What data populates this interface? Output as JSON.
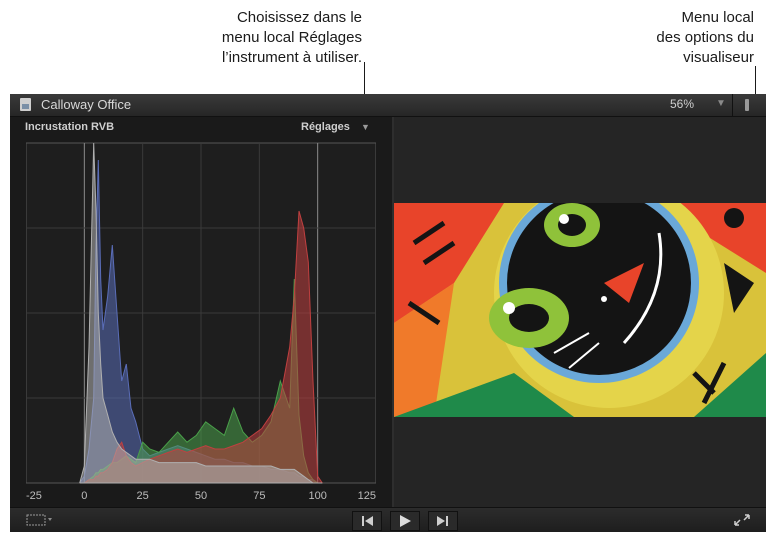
{
  "callouts": {
    "settings_lines": [
      "Choisissez dans le",
      "menu local Réglages",
      "l’instrument à utiliser."
    ],
    "viewer_lines": [
      "Menu local",
      "des options du",
      "visualiseur"
    ]
  },
  "window": {
    "title": "Calloway Office",
    "zoom": "56%",
    "accent_icon": "document-icon"
  },
  "scope": {
    "title": "Incrustation RVB",
    "settings_label": "Réglages",
    "axis_ticks": [
      "-25",
      "0",
      "25",
      "50",
      "75",
      "100",
      "125"
    ]
  },
  "chart_data": {
    "type": "area",
    "xlim": [
      -25,
      125
    ],
    "x": [
      -2,
      0,
      2,
      4,
      5,
      6,
      7,
      8,
      10,
      12,
      14,
      16,
      18,
      20,
      22,
      25,
      28,
      32,
      36,
      40,
      44,
      48,
      52,
      56,
      60,
      64,
      68,
      72,
      76,
      80,
      84,
      88,
      90,
      92,
      94,
      96,
      98,
      100,
      102
    ],
    "series": [
      {
        "name": "",
        "color": "#5a6db8",
        "values": [
          0,
          2,
          10,
          25,
          70,
          95,
          60,
          45,
          55,
          70,
          50,
          30,
          35,
          22,
          18,
          10,
          8,
          9,
          10,
          11,
          10,
          9,
          8,
          7,
          7,
          6,
          6,
          5,
          5,
          4,
          4,
          3,
          3,
          2,
          2,
          1,
          1,
          0,
          0
        ]
      },
      {
        "name": "",
        "color": "#4aa04a",
        "values": [
          0,
          0,
          1,
          2,
          3,
          3,
          4,
          4,
          5,
          6,
          6,
          7,
          8,
          7,
          6,
          12,
          10,
          9,
          12,
          15,
          12,
          14,
          18,
          16,
          14,
          22,
          15,
          12,
          14,
          18,
          30,
          22,
          60,
          20,
          8,
          3,
          1,
          0,
          0
        ]
      },
      {
        "name": "",
        "color": "#c04040",
        "values": [
          0,
          0,
          1,
          1,
          2,
          2,
          3,
          3,
          4,
          6,
          10,
          12,
          8,
          6,
          5,
          6,
          7,
          8,
          9,
          10,
          9,
          10,
          11,
          10,
          10,
          11,
          12,
          14,
          16,
          20,
          25,
          40,
          55,
          80,
          75,
          65,
          30,
          2,
          0
        ]
      },
      {
        "name": "",
        "color": "#b0b0b0",
        "values": [
          0,
          5,
          40,
          100,
          80,
          50,
          35,
          25,
          20,
          15,
          12,
          10,
          9,
          8,
          7,
          7,
          7,
          6,
          6,
          6,
          6,
          6,
          5,
          5,
          5,
          5,
          5,
          5,
          5,
          5,
          4,
          4,
          4,
          3,
          2,
          1,
          0,
          0,
          0
        ]
      }
    ],
    "ylim": [
      0,
      100
    ],
    "grid": true
  },
  "icons": {
    "view_options": "viewer-options-icon",
    "crop": "crop-icon",
    "prev": "skip-back-icon",
    "play": "play-icon",
    "next": "skip-forward-icon",
    "fullscreen": "fullscreen-icon"
  }
}
